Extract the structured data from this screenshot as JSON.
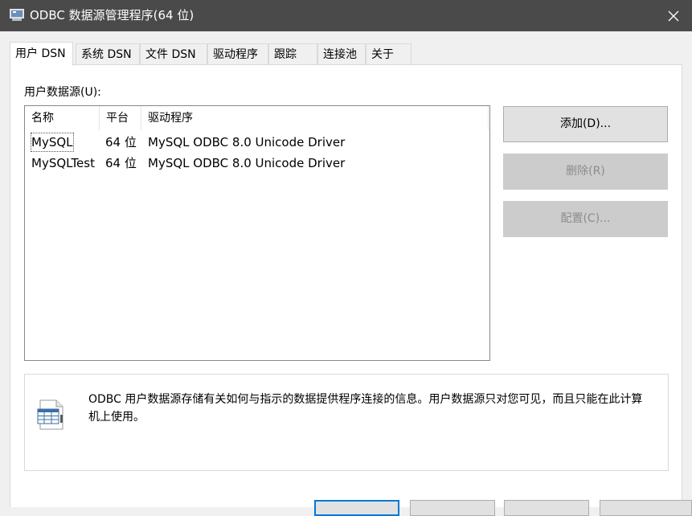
{
  "window": {
    "title": "ODBC 数据源管理程序(64 位)"
  },
  "tabs": [
    {
      "label": "用户 DSN",
      "active": true
    },
    {
      "label": "系统 DSN",
      "active": false
    },
    {
      "label": "文件 DSN",
      "active": false
    },
    {
      "label": "驱动程序",
      "active": false
    },
    {
      "label": "跟踪",
      "active": false
    },
    {
      "label": "连接池",
      "active": false
    },
    {
      "label": "关于",
      "active": false
    }
  ],
  "user_dsn": {
    "list_label": "用户数据源(U):",
    "columns": [
      "名称",
      "平台",
      "驱动程序"
    ],
    "rows": [
      {
        "name": "MySQL",
        "platform": "64 位",
        "driver": "MySQL ODBC 8.0 Unicode Driver"
      },
      {
        "name": "MySQLTest",
        "platform": "64 位",
        "driver": "MySQL ODBC 8.0 Unicode Driver"
      }
    ],
    "buttons": {
      "add": "添加(D)...",
      "remove": "删除(R)",
      "configure": "配置(C)..."
    },
    "info_text": "ODBC 用户数据源存储有关如何与指示的数据提供程序连接的信息。用户数据源只对您可见，而且只能在此计算机上使用。"
  },
  "icons": {
    "app": "odbc-app-icon",
    "close": "close-icon",
    "info": "datasource-document-icon"
  }
}
